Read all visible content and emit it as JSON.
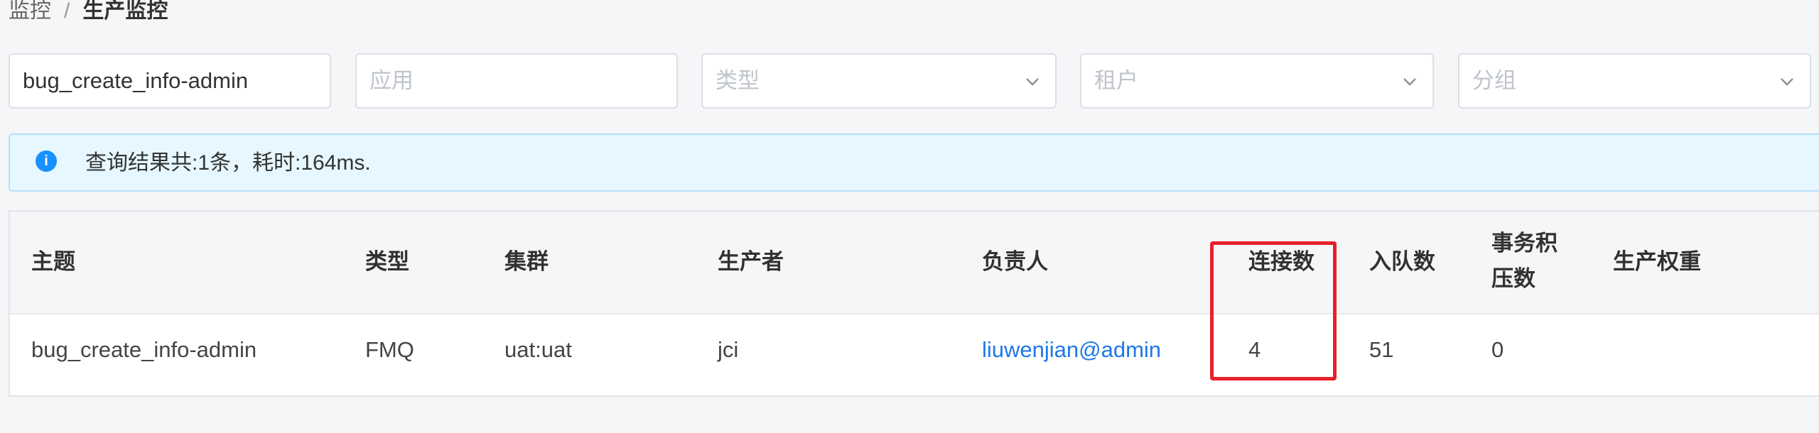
{
  "breadcrumb": {
    "parent": "监控",
    "separator": "/",
    "current": "生产监控"
  },
  "filters": {
    "topic": {
      "value": "bug_create_info-admin"
    },
    "app": {
      "placeholder": "应用"
    },
    "type": {
      "placeholder": "类型"
    },
    "tenant": {
      "placeholder": "租户"
    },
    "group": {
      "placeholder": "分组"
    }
  },
  "alert": {
    "icon": "info-icon",
    "message": "查询结果共:1条，耗时:164ms."
  },
  "table": {
    "headers": {
      "topic": "主题",
      "type": "类型",
      "cluster": "集群",
      "producer": "生产者",
      "owner": "负责人",
      "connections": "连接数",
      "enqueue": "入队数",
      "backlog_line1": "事务积",
      "backlog_line2": "压数",
      "weight": "生产权重"
    },
    "rows": [
      {
        "topic": "bug_create_info-admin",
        "type": "FMQ",
        "cluster": "uat:uat",
        "producer": "jci",
        "owner": "liuwenjian@admin",
        "connections": "4",
        "enqueue": "51",
        "backlog": "0",
        "weight": ""
      }
    ]
  },
  "colors": {
    "accent": "#1890ff",
    "link": "#1e78e6",
    "highlight_border": "#e8202a",
    "alert_bg": "#e6f7ff"
  }
}
